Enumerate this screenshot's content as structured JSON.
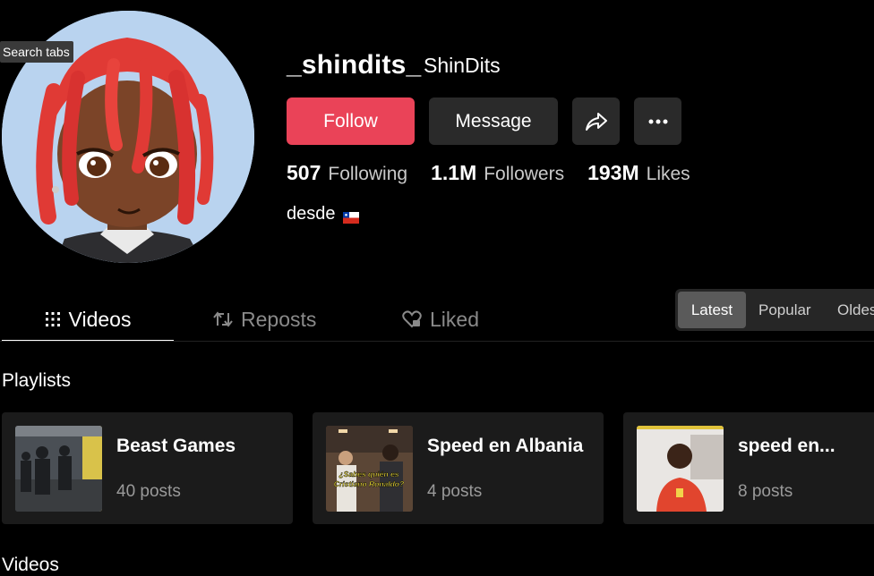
{
  "tooltip": "Search tabs",
  "profile": {
    "username": "_shindits_",
    "nickname": "ShinDits",
    "bio": "desde",
    "bio_flag_icon": "chile-flag-icon"
  },
  "actions": {
    "follow": "Follow",
    "message": "Message",
    "share_icon": "share-icon",
    "more_icon": "more-icon"
  },
  "stats": [
    {
      "num": "507",
      "label": "Following"
    },
    {
      "num": "1.1M",
      "label": "Followers"
    },
    {
      "num": "193M",
      "label": "Likes"
    }
  ],
  "tabs": {
    "videos": "Videos",
    "reposts": "Reposts",
    "liked": "Liked"
  },
  "sort": {
    "latest": "Latest",
    "popular": "Popular",
    "oldest": "Oldest"
  },
  "playlists": {
    "title": "Playlists",
    "items": [
      {
        "name": "Beast Games",
        "count": "40 posts"
      },
      {
        "name": "Speed en Albania",
        "count": "4 posts",
        "thumb_caption": "¿Sabes quién es Cristiano Ronaldo?"
      },
      {
        "name": "speed en...",
        "count": "8 posts"
      }
    ]
  },
  "videos_title": "Videos",
  "colors": {
    "accent": "#ea4358",
    "background": "#000000",
    "button": "#2a2a2a"
  }
}
